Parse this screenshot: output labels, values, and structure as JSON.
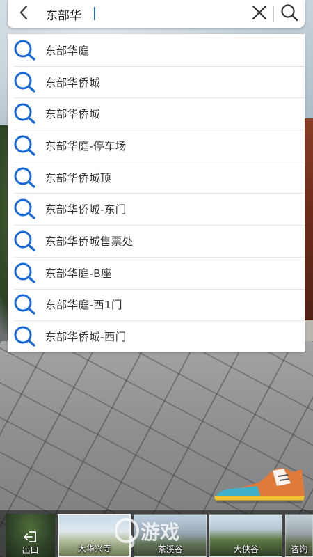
{
  "search": {
    "query": "东部华",
    "placeholder": ""
  },
  "suggestions": [
    "东部华庭",
    "东部华侨城",
    "东部华侨城",
    "东部华庭-停车场",
    "东部华侨城顶",
    "东部华侨城-东门",
    "东部华侨城售票处",
    "东部华庭-B座",
    "东部华庭-西1门",
    "东部华侨城-西门"
  ],
  "bottom_bar": {
    "exit_label": "出口",
    "thumbnails": [
      "大华兴寺",
      "茶溪谷",
      "大侠谷",
      "咨询"
    ]
  },
  "watermark": "游戏",
  "colors": {
    "accent": "#1f6fd6",
    "search_icon": "#1a6ad6",
    "text": "#333333",
    "shoe_top": "#e07a3a",
    "shoe_toe": "#3fb0c9",
    "shoe_sole": "#f2c438"
  },
  "icons": {
    "back": "chevron-left-icon",
    "clear": "close-icon",
    "search": "search-icon",
    "exit": "exit-icon",
    "shoe": "walk-shoe-icon"
  }
}
